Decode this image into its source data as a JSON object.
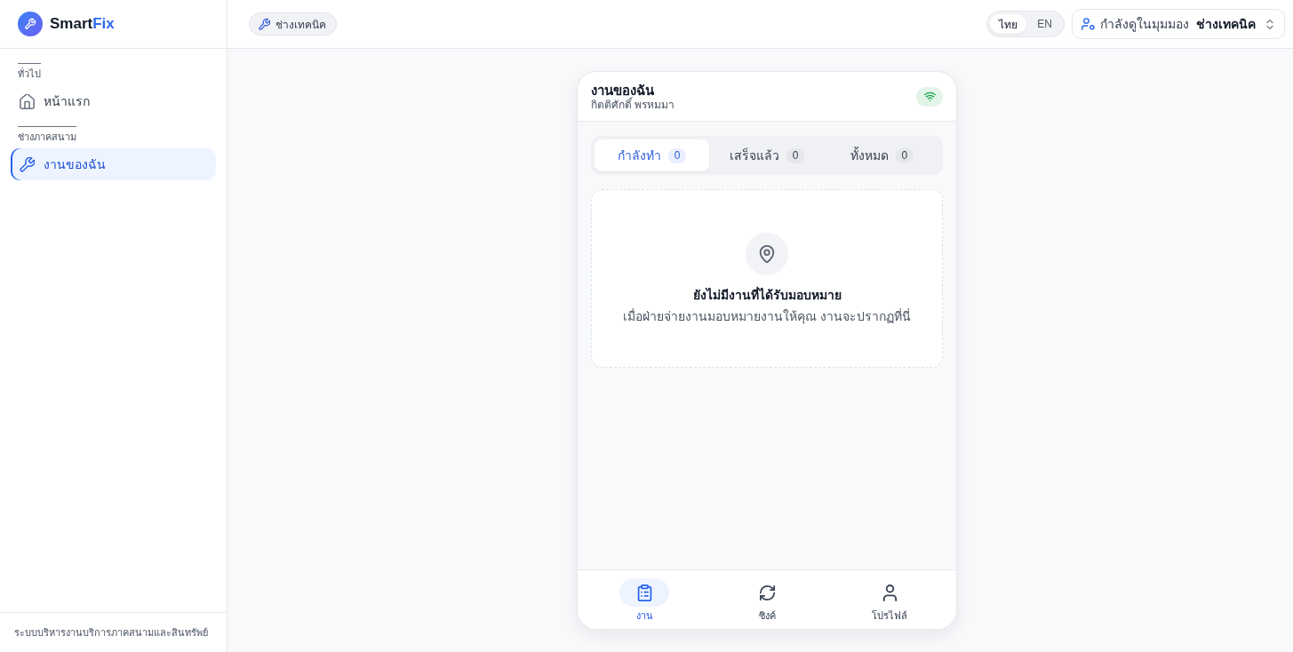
{
  "brand": {
    "name": "Smart",
    "accent": "Fix"
  },
  "sidebar": {
    "sections": [
      {
        "title": "ทั่วไป",
        "items": [
          {
            "label": "หน้าแรก",
            "selected": false
          }
        ]
      },
      {
        "title": "ช่างภาคสนาม",
        "items": [
          {
            "label": "งานของฉัน",
            "selected": true
          }
        ]
      }
    ],
    "footer": "ระบบบริหารงานบริการภาคสนามและสินทรัพย์"
  },
  "header": {
    "role_badge": "ช่างเทคนิค",
    "languages": [
      {
        "label": "ไทย",
        "selected": true
      },
      {
        "label": "EN",
        "selected": false
      }
    ],
    "view_as": {
      "label": "กำลังดูในมุมมอง",
      "value": "ช่างเทคนิค"
    }
  },
  "phone": {
    "title": "งานของฉัน",
    "subtitle": "กิตติศักดิ์ พรหมมา",
    "online": true,
    "tabs": [
      {
        "label": "กำลังทำ",
        "count": "0",
        "selected": true
      },
      {
        "label": "เสร็จแล้ว",
        "count": "0",
        "selected": false
      },
      {
        "label": "ทั้งหมด",
        "count": "0",
        "selected": false
      }
    ],
    "empty_state": {
      "title": "ยังไม่มีงานที่ได้รับมอบหมาย",
      "message": "เมื่อฝ่ายจ่ายงานมอบหมายงานให้คุณ งานจะปรากฏที่นี่"
    },
    "bottom_nav": [
      {
        "label": "งาน",
        "selected": true
      },
      {
        "label": "ซิงค์",
        "selected": false
      },
      {
        "label": "โปรไฟล์",
        "selected": false
      }
    ]
  }
}
